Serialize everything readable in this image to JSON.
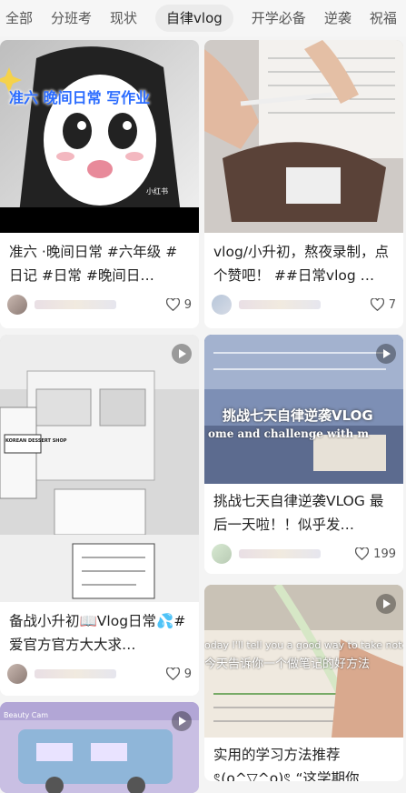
{
  "tabs": [
    "全部",
    "分班考",
    "现状",
    "自律vlog",
    "开学必备",
    "逆袭",
    "祝福"
  ],
  "active_tab_index": 3,
  "cards": {
    "c1": {
      "title": "准六 ·晚间日常 #六年级 #日记 #日常 #晚间日…",
      "likes": "9",
      "overlay_text": "准六 晚间日常 写作业",
      "watermark": "小红书"
    },
    "c2": {
      "title": "vlog/小升初，熬夜录制，点个赞吧！ ##日常vlog …",
      "likes": "7"
    },
    "c3": {
      "title": "备战小升初📖Vlog日常💦#爱官方官方大大求…",
      "likes": "9",
      "overlay_text": "KOREAN DESSERT SHOP"
    },
    "c4": {
      "title": "挑战七天自律逆袭VLOG 最后一天啦！！似乎发…",
      "likes": "199",
      "overlay_text": "挑战七天自律逆袭VLOG",
      "overlay_sub": "ome and challenge with m"
    },
    "c5": {
      "title": "",
      "overlay_text": "Beauty Cam"
    },
    "c6": {
      "title": "实用的学习方法推荐 ৎ(o^▽^o)ৎ “这学期你…",
      "overlay_en": "oday I'll tell you a good way to take note",
      "overlay_cn": "今天告诉你一个做笔记的好方法"
    }
  },
  "colors": {
    "tab_active_bg": "#ebebeb",
    "overlay_blue": "#2b6cff"
  },
  "icons": {
    "like": "heart-outline-icon",
    "video": "play-icon"
  }
}
